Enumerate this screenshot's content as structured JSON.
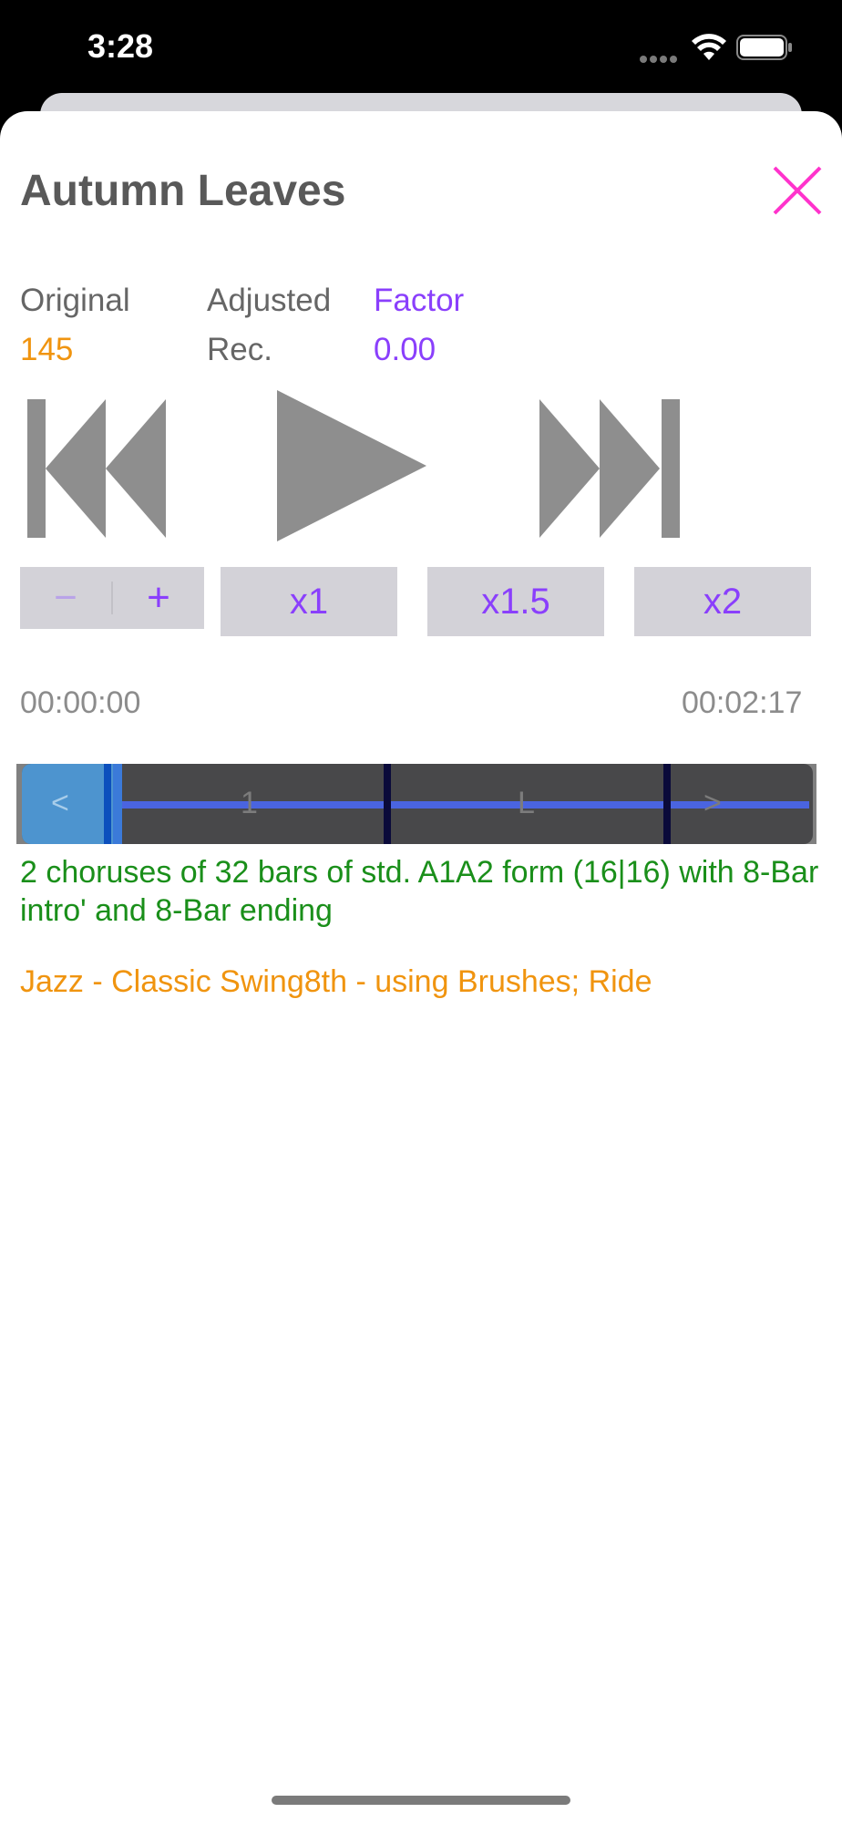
{
  "status_bar": {
    "time": "3:28"
  },
  "sheet": {
    "title": "Autumn Leaves",
    "close_icon": "close-x-icon"
  },
  "tempo": {
    "original_label": "Original",
    "original_value": "145",
    "adjusted_label": "Adjusted",
    "adjusted_value": "Rec.",
    "factor_label": "Factor",
    "factor_value": "0.00"
  },
  "transport": {
    "previous_icon": "skip-back-icon",
    "play_icon": "play-icon",
    "next_icon": "skip-forward-icon"
  },
  "controls": {
    "stepper_minus": "−",
    "stepper_plus": "+",
    "speed_x1": "x1",
    "speed_x15": "x1.5",
    "speed_x2": "x2"
  },
  "time": {
    "current": "00:00:00",
    "total": "00:02:17"
  },
  "timeline": {
    "left_arrow": "<",
    "marker_1": "1",
    "marker_2": "L",
    "right_arrow": ">"
  },
  "description": "2 choruses of 32 bars of std. A1A2 form (16|16) with 8-Bar intro' and 8-Bar ending",
  "style": "Jazz - Classic Swing8th - using Brushes; Ride",
  "colors": {
    "accent": "#8a3ffc",
    "orange": "#f0940f",
    "green": "#1a8f1a",
    "close": "#ff33cc"
  }
}
